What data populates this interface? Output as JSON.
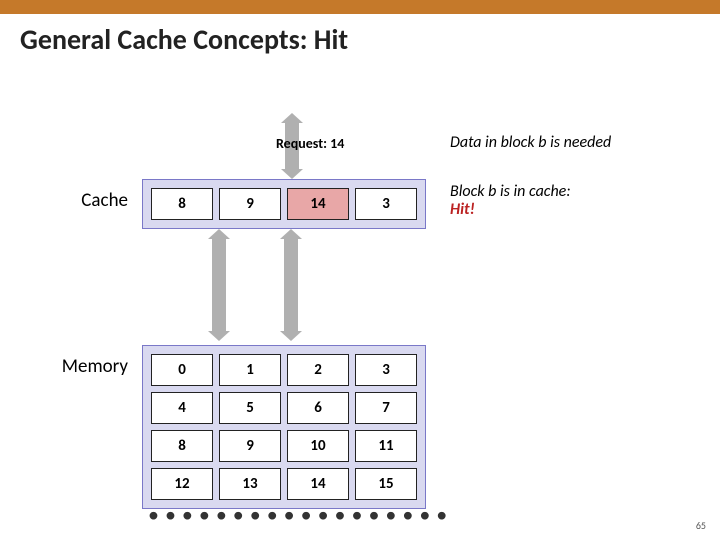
{
  "title": "General Cache Concepts: Hit",
  "request_label": "Request: 14",
  "needed_text": "Data in block b is needed",
  "hit_text_line1": "Block b is in cache:",
  "hit_word": "Hit!",
  "labels": {
    "cache": "Cache",
    "memory": "Memory"
  },
  "cache_row": [
    "8",
    "9",
    "14",
    "3"
  ],
  "hit_index": 2,
  "memory": [
    [
      "0",
      "1",
      "2",
      "3"
    ],
    [
      "4",
      "5",
      "6",
      "7"
    ],
    [
      "8",
      "9",
      "10",
      "11"
    ],
    [
      "12",
      "13",
      "14",
      "15"
    ]
  ],
  "slide_number": "65"
}
